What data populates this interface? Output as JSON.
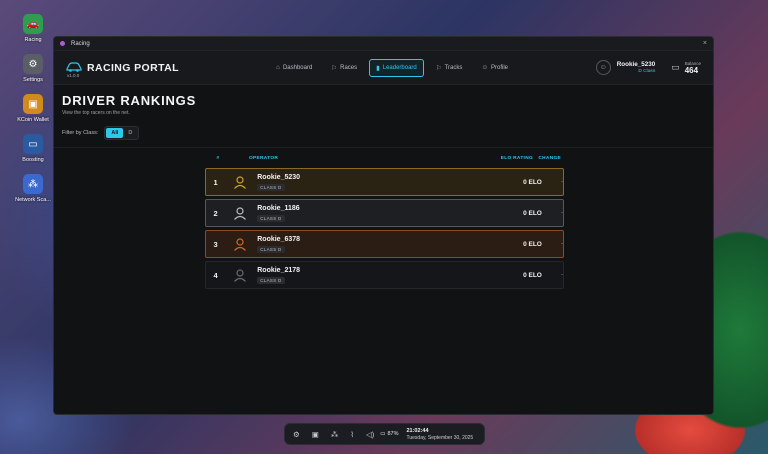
{
  "desktop": {
    "icons": [
      {
        "label": "Racing",
        "icon": "car-icon",
        "color": "#2e9d4f"
      },
      {
        "label": "Settings",
        "icon": "gear-icon",
        "color": "#5a5e66"
      },
      {
        "label": "KCoin Wallet",
        "icon": "wallet-icon",
        "color": "#d08a1e"
      },
      {
        "label": "Boosting",
        "icon": "laptop-icon",
        "color": "#2a5aa0"
      },
      {
        "label": "Network Sca...",
        "icon": "network-icon",
        "color": "#3a6ad0"
      }
    ]
  },
  "window": {
    "title": "Racing",
    "close_glyph": "×"
  },
  "header": {
    "brand": "RACING PORTAL",
    "version": "v1.0.0",
    "nav": [
      {
        "label": "Dashboard",
        "icon": "home-icon",
        "active": false
      },
      {
        "label": "Races",
        "icon": "flag-icon",
        "active": false
      },
      {
        "label": "Leaderboard",
        "icon": "bar-chart-icon",
        "active": true
      },
      {
        "label": "Tracks",
        "icon": "flag-icon",
        "active": false
      },
      {
        "label": "Profile",
        "icon": "user-icon",
        "active": false
      }
    ],
    "user": {
      "name": "Rookie_5230",
      "class": "D Class"
    },
    "balance": {
      "label": "Balance",
      "value": "464"
    }
  },
  "main": {
    "title": "DRIVER RANKINGS",
    "subtitle": "View the top racers on the net.",
    "filter": {
      "label": "Filter by Class:",
      "options": [
        "All",
        "D"
      ],
      "selected": "All"
    },
    "table": {
      "headers": {
        "rank": "#",
        "operator": "OPERATOR",
        "elo": "ELO RATING",
        "change": "CHANGE"
      },
      "rows": [
        {
          "rank": "1",
          "name": "Rookie_5230",
          "class": "CLASS D",
          "elo": "0 ELO",
          "change": "-",
          "tier": "gold"
        },
        {
          "rank": "2",
          "name": "Rookie_1186",
          "class": "CLASS D",
          "elo": "0 ELO",
          "change": "-",
          "tier": "silver"
        },
        {
          "rank": "3",
          "name": "Rookie_6378",
          "class": "CLASS D",
          "elo": "0 ELO",
          "change": "-",
          "tier": "bronze"
        },
        {
          "rank": "4",
          "name": "Rookie_2178",
          "class": "CLASS D",
          "elo": "0 ELO",
          "change": "-",
          "tier": "plain"
        }
      ]
    }
  },
  "colors": {
    "accent": "#2ec8ea",
    "gold": "#d4a12a",
    "silver": "#b9bcc3",
    "bronze": "#d0692a",
    "plain": "#6a6d74"
  },
  "taskbar": {
    "battery": "87%",
    "time": "21:02:44",
    "date": "Tuesday, September 30, 2025"
  }
}
